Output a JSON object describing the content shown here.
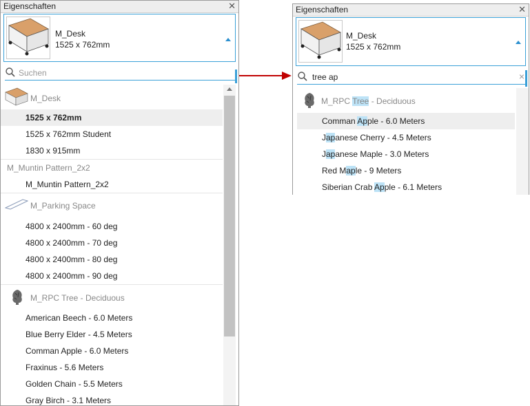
{
  "left_panel": {
    "title": "Eigenschaften",
    "close_icon": "close-icon",
    "selector": {
      "name": "M_Desk",
      "size": "1525 x 762mm"
    },
    "search": {
      "placeholder": "Suchen",
      "value": ""
    },
    "groups": [
      {
        "label": "M_Desk",
        "icon": "desk-icon",
        "items": [
          {
            "label": "1525 x 762mm",
            "selected": true
          },
          {
            "label": "1525 x 762mm Student"
          },
          {
            "label": "1830 x 915mm"
          }
        ]
      },
      {
        "label": "M_Muntin Pattern_2x2",
        "icon": "",
        "items": [
          {
            "label": "M_Muntin Pattern_2x2"
          }
        ]
      },
      {
        "label": "M_Parking Space",
        "icon": "parking-space-icon",
        "items": [
          {
            "label": "4800 x 2400mm - 60 deg"
          },
          {
            "label": "4800 x 2400mm - 70 deg"
          },
          {
            "label": "4800 x 2400mm - 80 deg"
          },
          {
            "label": "4800 x 2400mm - 90 deg"
          }
        ]
      },
      {
        "label": "M_RPC Tree - Deciduous",
        "icon": "tree-icon",
        "items": [
          {
            "label": "American Beech - 6.0 Meters"
          },
          {
            "label": "Blue Berry Elder - 4.5 Meters"
          },
          {
            "label": "Comman Apple - 6.0 Meters"
          },
          {
            "label": "Fraxinus - 5.6 Meters"
          },
          {
            "label": "Golden Chain - 5.5 Meters"
          },
          {
            "label": "Gray Birch - 3.1 Meters"
          }
        ]
      }
    ]
  },
  "arrow": {
    "color": "#c00000"
  },
  "right_panel": {
    "title": "Eigenschaften",
    "close_icon": "close-icon",
    "selector": {
      "name": "M_Desk",
      "size": "1525 x 762mm"
    },
    "search": {
      "placeholder": "Suchen",
      "value": "tree ap"
    },
    "group": {
      "pre": "M_RPC ",
      "hl": "Tree",
      "post": " - Deciduous",
      "icon": "tree-icon"
    },
    "results": [
      {
        "pre": "Comman ",
        "hl": "Ap",
        "post": "ple - 6.0 Meters",
        "selected": true
      },
      {
        "pre": "J",
        "hl": "ap",
        "post": "anese Cherry - 4.5 Meters"
      },
      {
        "pre": "J",
        "hl": "ap",
        "post": "anese Maple - 3.0 Meters"
      },
      {
        "pre": "Red M",
        "hl": "ap",
        "post": "le - 9 Meters"
      },
      {
        "pre": "Siberian Crab ",
        "hl": "Ap",
        "post": "ple - 6.1 Meters"
      }
    ]
  },
  "colors": {
    "accent": "#3aa0d8",
    "highlight": "#bde3f7",
    "selected_row": "#eeeeee"
  }
}
